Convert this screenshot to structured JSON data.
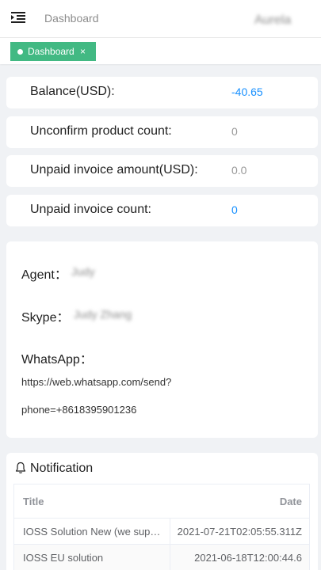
{
  "header": {
    "title": "Dashboard",
    "user_name": "Aurela"
  },
  "tags": [
    {
      "label": "Dashboard",
      "close": "×"
    }
  ],
  "stats": [
    {
      "label": "Balance(USD):",
      "value": "-40.65",
      "color": "#1890ff"
    },
    {
      "label": "Unconfirm product count:",
      "value": "0",
      "color": "#999999"
    },
    {
      "label": "Unpaid invoice amount(USD):",
      "value": "0.0",
      "color": "#999999"
    },
    {
      "label": "Unpaid invoice count:",
      "value": "0",
      "color": "#1890ff"
    }
  ],
  "contact": {
    "agent_label": "Agent：",
    "agent_value": "Judy",
    "skype_label": "Skype：",
    "skype_value": "Judy Zhang",
    "whatsapp_label": "WhatsApp：",
    "whatsapp_line1": "https://web.whatsapp.com/send?",
    "whatsapp_line2": "phone=+8618395901236"
  },
  "notification": {
    "title": "Notification",
    "icon": "bell-icon",
    "columns": {
      "title": "Title",
      "date": "Date"
    },
    "rows": [
      {
        "title": "IOSS Solution New (we support to help you to get IOSS number)",
        "date": "2021-07-21T02:05:55.311Z"
      },
      {
        "title": "IOSS EU solution",
        "date": "2021-06-18T12:00:44.6"
      }
    ]
  },
  "colors": {
    "accent": "#42b983",
    "link": "#1890ff",
    "background": "#f0f2f5"
  }
}
